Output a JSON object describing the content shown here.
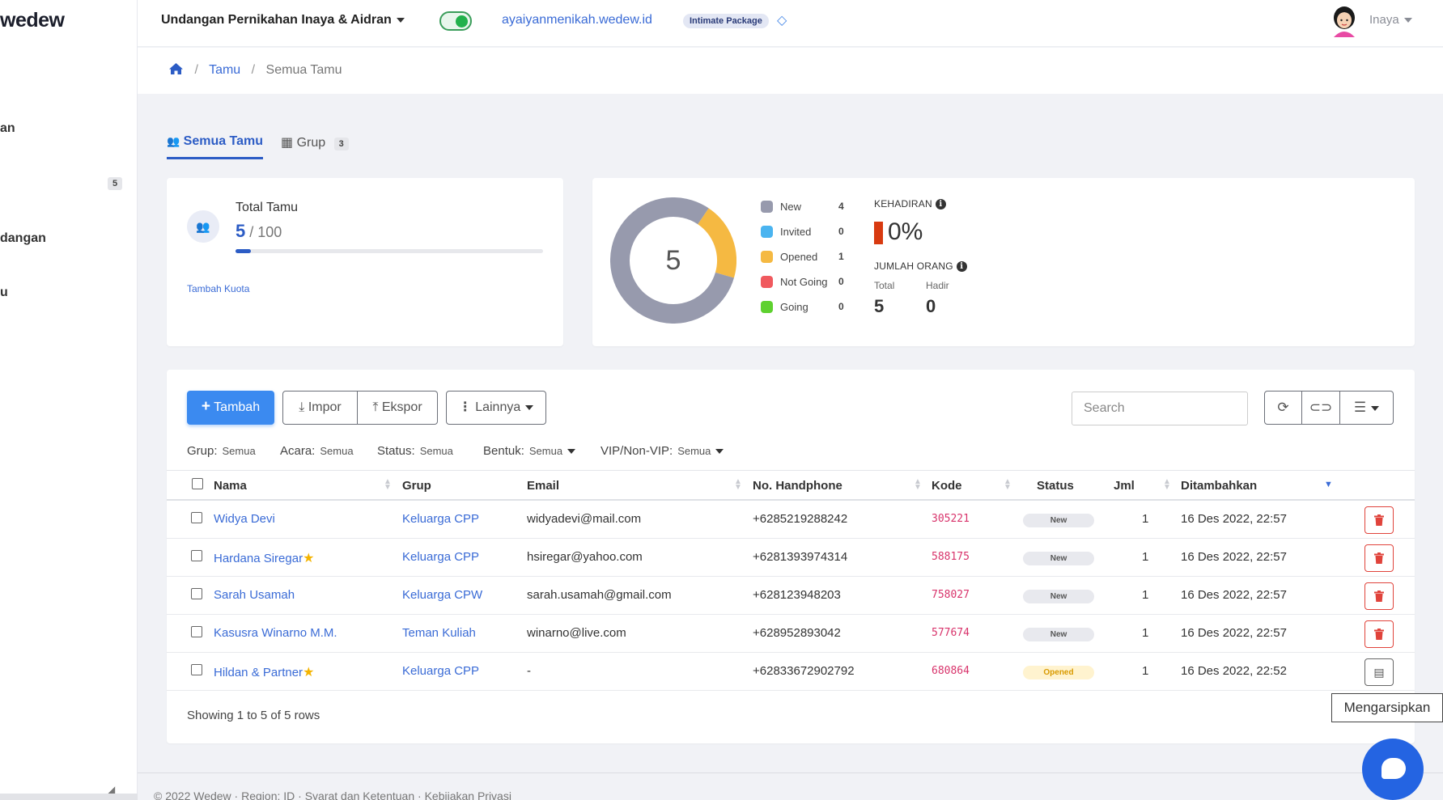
{
  "sidebar": {
    "logo": "wedew",
    "items": [
      {
        "label": "an"
      },
      {
        "label": "dangan"
      },
      {
        "label": "u"
      }
    ],
    "badge": "5"
  },
  "topbar": {
    "event_title": "Undangan Pernikahan Inaya & Aidran",
    "toggle_on": true,
    "site_link": "ayaiyanmenikah.wedew.id",
    "package": "Intimate Package",
    "username": "Inaya"
  },
  "breadcrumb": {
    "tamu": "Tamu",
    "current": "Semua Tamu"
  },
  "tabs": [
    {
      "label": "Semua Tamu",
      "active": true
    },
    {
      "label": "Grup",
      "count": "3",
      "active": false
    }
  ],
  "total_tamu": {
    "label": "Total Tamu",
    "value": "5",
    "quota": "/ 100",
    "progress": 0.05,
    "link": "Tambah Kuota"
  },
  "status_chart": {
    "center": "5",
    "legend": [
      {
        "label": "New",
        "count": "4",
        "color": "#979aad"
      },
      {
        "label": "Invited",
        "count": "0",
        "color": "#4ab4f0"
      },
      {
        "label": "Opened",
        "count": "1",
        "color": "#f5b942"
      },
      {
        "label": "Not Going",
        "count": "0",
        "color": "#f0595e"
      },
      {
        "label": "Going",
        "count": "0",
        "color": "#5ed12f"
      }
    ],
    "kehadiran_label": "KEHADIRAN",
    "kehadiran_value": "0%",
    "jumlah_label": "JUMLAH ORANG",
    "total_label": "Total",
    "total_value": "5",
    "hadir_label": "Hadir",
    "hadir_value": "0"
  },
  "toolbar": {
    "add": "Tambah",
    "import": "Impor",
    "export": "Ekspor",
    "more": "Lainnya",
    "search_placeholder": "Search"
  },
  "filters": [
    {
      "label": "Grup:",
      "value": "Semua"
    },
    {
      "label": "Acara:",
      "value": "Semua"
    },
    {
      "label": "Status:",
      "value": "Semua"
    },
    {
      "label": "Bentuk:",
      "value": "Semua"
    },
    {
      "label": "VIP/Non-VIP:",
      "value": "Semua"
    }
  ],
  "table": {
    "headers": {
      "nama": "Nama",
      "grup": "Grup",
      "email": "Email",
      "hp": "No. Handphone",
      "kode": "Kode",
      "status": "Status",
      "jml": "Jml",
      "added": "Ditambahkan"
    },
    "rows": [
      {
        "nama": "Widya Devi",
        "vip": false,
        "grup": "Keluarga CPP",
        "email": "widyadevi@mail.com",
        "hp": "+6285219288242",
        "kode": "305221",
        "status": "New",
        "jml": "1",
        "added": "16 Des 2022, 22:57",
        "action": "delete"
      },
      {
        "nama": "Hardana Siregar",
        "vip": true,
        "grup": "Keluarga CPP",
        "email": "hsiregar@yahoo.com",
        "hp": "+6281393974314",
        "kode": "588175",
        "status": "New",
        "jml": "1",
        "added": "16 Des 2022, 22:57",
        "action": "delete"
      },
      {
        "nama": "Sarah Usamah",
        "vip": false,
        "grup": "Keluarga CPW",
        "email": "sarah.usamah@gmail.com",
        "hp": "+628123948203",
        "kode": "758027",
        "status": "New",
        "jml": "1",
        "added": "16 Des 2022, 22:57",
        "action": "delete"
      },
      {
        "nama": "Kasusra Winarno M.M.",
        "vip": false,
        "grup": "Teman Kuliah",
        "email": "winarno@live.com",
        "hp": "+628952893042",
        "kode": "577674",
        "status": "New",
        "jml": "1",
        "added": "16 Des 2022, 22:57",
        "action": "delete"
      },
      {
        "nama": "Hildan & Partner",
        "vip": true,
        "grup": "Keluarga CPP",
        "email": "-",
        "hp": "+62833672902792",
        "kode": "680864",
        "status": "Opened",
        "jml": "1",
        "added": "16 Des 2022, 22:52",
        "action": "archive"
      }
    ],
    "showing": "Showing 1 to 5 of 5 rows"
  },
  "tooltip": "Mengarsipkan",
  "footer": "© 2022 Wedew · Region: ID · Syarat dan Ketentuan · Kebijakan Privasi"
}
